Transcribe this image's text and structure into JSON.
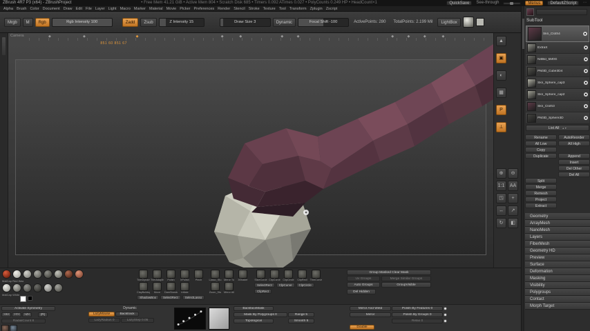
{
  "accent": "#cc7a2e",
  "title_bar": {
    "title": "ZBrush 4R7 P3 (x64) - ZBrushProject",
    "stats": "• Free Mem 41.21 GiB • Active Mem 804 • Scratch Disk 685 • Timers 0.092  ATimes 0.027 • PolyCounts 0.249 HP • HeadCount×1",
    "quicksave": "QuickSave",
    "see_through": "See-through",
    "menus_button": "Menus",
    "zscript_button": "DefaultZScript"
  },
  "menus": [
    "Alpha",
    "Brush",
    "Color",
    "Document",
    "Draw",
    "Edit",
    "File",
    "Layer",
    "Light",
    "Macro",
    "Marker",
    "Material",
    "Movie",
    "Picker",
    "Preferences",
    "Render",
    "Stencil",
    "Stroke",
    "Texture",
    "Tool",
    "Transform",
    "Zplugin",
    "Zscript"
  ],
  "shelf": {
    "mrgb": "Mrgb",
    "m": "M",
    "rgb": "Rgb",
    "rgb_intensity": "Rgb Intensity 100",
    "zadd": "Zadd",
    "zsub": "Zsub",
    "z_intensity": "Z Intensity 15",
    "draw_size": "Draw Size 3",
    "dynamic": "Dynamic",
    "focal_shift": "Focal Shift -100",
    "active_points": "ActivePoints: 280",
    "total_points": "TotalPoints: 2.199 Mil",
    "lightbox": "LightBox"
  },
  "canvas": {
    "camera_label": "Camera",
    "timeline_label": "851 60  851 67",
    "timeline_markers_pct": [
      4.5,
      12,
      23.5,
      42,
      46,
      55,
      58.5,
      79,
      82.5,
      86,
      90
    ],
    "active_marker_pct": 23.5
  },
  "right_shelf": {
    "top": [
      {
        "name": "scroll-up-icon",
        "glyph": "▲",
        "active": false
      },
      {
        "name": "bpr-render-button",
        "glyph": "▣",
        "active": true
      },
      {
        "name": "transparency-button",
        "glyph": "◐",
        "active": false
      },
      {
        "name": "polyframe-button",
        "glyph": "▦",
        "active": false
      },
      {
        "name": "persp-button",
        "glyph": "P",
        "active": true
      },
      {
        "name": "floor-grid-button",
        "glyph": "⊥",
        "active": true
      }
    ],
    "grid": [
      {
        "name": "zoom-in-button",
        "glyph": "⊕",
        "active": false
      },
      {
        "name": "zoom-out-button",
        "glyph": "⊖",
        "active": false
      },
      {
        "name": "actual-size-button",
        "glyph": "1:1",
        "active": false
      },
      {
        "name": "aa-half-button",
        "glyph": "AA",
        "active": false
      },
      {
        "name": "frame-button",
        "glyph": "◳",
        "active": false
      },
      {
        "name": "scroll-canvas-button",
        "glyph": "+",
        "active": false
      },
      {
        "name": "move-canvas-button",
        "glyph": "↔",
        "active": false
      },
      {
        "name": "scale-canvas-button",
        "glyph": "↗",
        "active": false
      },
      {
        "name": "rotate-canvas-button",
        "glyph": "↻",
        "active": false
      },
      {
        "name": "solo-button",
        "glyph": "◧",
        "active": false
      }
    ]
  },
  "subtool": {
    "header": "SubTool",
    "list_all": "List All",
    "items": [
      {
        "name": "Skn_Cloth4",
        "color": "#5d3a47",
        "selected": true
      },
      {
        "name": "ExtraX",
        "color": "#93938a",
        "selected": false
      },
      {
        "name": "NitBld_5M0G",
        "color": "#6f6f67",
        "selected": false
      },
      {
        "name": "PM3D_Cube3D4",
        "color": "#54544e",
        "selected": false
      },
      {
        "name": "Skn_Sphere_cap3",
        "color": "#b2b2a6",
        "selected": false
      },
      {
        "name": "Skn_Sphere_cap2",
        "color": "#a4a498",
        "selected": false
      },
      {
        "name": "Skn_Cloth3",
        "color": "#5d3a47",
        "selected": false
      },
      {
        "name": "PM3D_Sphere3D",
        "color": "#42423e",
        "selected": false
      }
    ],
    "buttons_rows": [
      [
        "Rename",
        "AutoReorder"
      ],
      [
        "All Low",
        "All High"
      ],
      [
        "Copy",
        ""
      ],
      [
        "Duplicate",
        "Append"
      ],
      [
        "",
        "Insert"
      ],
      [
        "",
        "Del Other"
      ],
      [
        "",
        "Del All"
      ],
      [
        "Split",
        ""
      ],
      [
        "Merge",
        ""
      ],
      [
        "Remesh",
        ""
      ],
      [
        "Project",
        ""
      ],
      [
        "Extract",
        ""
      ]
    ]
  },
  "tool_sections": [
    "Geometry",
    "ArrayMesh",
    "NanoMesh",
    "Layers",
    "FiberMesh",
    "Geometry HD",
    "Preview",
    "Surface",
    "Deformation",
    "Masking",
    "Visibility",
    "Polygroups",
    "Contact",
    "Morph Target"
  ],
  "materials": {
    "label1": "MatCap Red Wax",
    "label2": "MatCap White",
    "row1": [
      [
        "#d95c3c",
        "#541204"
      ],
      [
        "#f0efe9",
        "#9b9b93"
      ],
      [
        "#d2d2cc",
        "#73736d"
      ],
      [
        "#ababa5",
        "#4c4c46"
      ],
      [
        "#8e8e88",
        "#31312b"
      ],
      [
        "#c4c4bc",
        "#5a5a52"
      ],
      [
        "#b06a50",
        "#3a1a0e"
      ],
      [
        "#e09478",
        "#6e3826"
      ]
    ],
    "row2": [
      [
        "#ecece6",
        "#8c8c86"
      ],
      [
        "#bcbcb6",
        "#52524c"
      ],
      [
        "#949490",
        "#3a3a34"
      ],
      [
        "#6c6c68",
        "#242420"
      ],
      [
        "#d2d2ce",
        "#6f6f6b"
      ],
      [
        "#a2a29c",
        "#44443e"
      ]
    ]
  },
  "brushes": {
    "a1": [
      "TrimDynamic",
      "TrimAdaptive",
      "Polish",
      "hPolish",
      "Pinch"
    ],
    "a2": [
      "ClayBuildup",
      "Move",
      "DamStandard",
      "Inflate"
    ],
    "a3": [
      "ShadowBox",
      "SelectRect",
      "SelectLasso"
    ],
    "b1": [
      "Lasso_Stu",
      "Mirror To",
      "3Shader"
    ],
    "b2": [
      "Zoom_Stu",
      "Mirror All"
    ],
    "c1": [
      "SliceCurve",
      "ClipCurve",
      "ClipCircle",
      "ClipRect",
      "TrimCurve"
    ],
    "c2": [
      "SelectRect",
      "ClpCurve",
      "ClpCircle"
    ],
    "c3": [
      "ClipRect"
    ]
  },
  "groups": {
    "group_masked_clear": "Group Masked Clear Mask",
    "uv_groups": "Uv Groups",
    "merge_similar": "Merge Similar Groups",
    "auto_groups": "Auto Groups",
    "group_visible": "GroupVisible",
    "del_hidden": "Del Hidden"
  },
  "strip": {
    "symmetry_header": "Activate Symmetry",
    "sym_x": ">X<",
    "sym_y": ">Y<",
    "sym_z": ">Z<",
    "sym_r": "(R)",
    "radial": "RadialCount 8",
    "dynamic_header": "Dynamic",
    "lazymouse": "LazyMouse",
    "backtrack": "Backtrack",
    "lazyradius": "LazyRadius 0",
    "lazystep": "LazyStep 0.05",
    "backface": "BackfaceMask",
    "mask_by_polygroups": "Mask By Polygroups 0",
    "topological": "Topological",
    "range": "Range 5",
    "smooth": "Smooth 5",
    "mirror_and_weld": "Mirror And Weld",
    "mirror": "Mirror",
    "polish_features": "Polish By Features 0",
    "polish_groups": "Polish By Groups 0",
    "relax": "Relax 0",
    "double": "Double"
  },
  "model": {
    "arm_light": "#7c4e5d",
    "arm_mid": "#5d3a47",
    "arm_dark": "#3a232d",
    "ball_light": "#dcdccf",
    "ball_mid": "#b5b5a8",
    "ball_dark": "#797972"
  }
}
